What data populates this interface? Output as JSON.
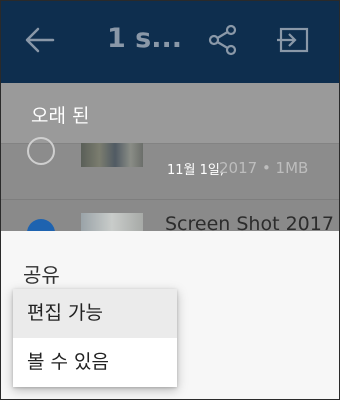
{
  "appbar": {
    "title": "1 s...",
    "icons": [
      "back-arrow-icon",
      "share-icon",
      "move-icon"
    ],
    "background": "#0e2e4e"
  },
  "list": {
    "section_title": "오래 된",
    "rows": [
      {
        "date": "11월 1일,",
        "info": "2017 • 1MB",
        "selected": false
      },
      {
        "title": "Screen Shot 2017",
        "selected": true
      }
    ]
  },
  "sheet": {
    "title": "공유",
    "menu": [
      {
        "label": "편집 가능",
        "selected": true
      },
      {
        "label": "볼 수 있음",
        "selected": false
      }
    ]
  },
  "colors": {
    "accent": "#1e63b0",
    "overlay": "#8f8f8f"
  }
}
